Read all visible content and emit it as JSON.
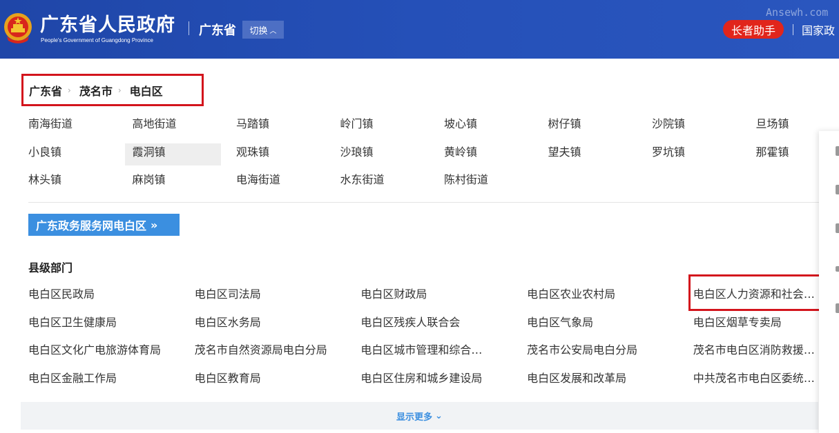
{
  "header": {
    "title": "广东省人民政府",
    "subtitle": "People's Government of Guangdong Province",
    "region": "广东省",
    "switch_label": "切换",
    "watermark": "Ansewh.com",
    "assistant_label": "长者助手",
    "national_link": "国家政"
  },
  "breadcrumb": {
    "items": [
      "广东省",
      "茂名市",
      "电白区"
    ]
  },
  "towns": [
    "南海街道",
    "高地街道",
    "马踏镇",
    "岭门镇",
    "坡心镇",
    "树仔镇",
    "沙院镇",
    "旦场镇",
    "小良镇",
    "霞洞镇",
    "观珠镇",
    "沙琅镇",
    "黄岭镇",
    "望夫镇",
    "罗坑镇",
    "那霍镇",
    "林头镇",
    "麻岗镇",
    "电海街道",
    "水东街道",
    "陈村街道"
  ],
  "highlighted_town": "霞洞镇",
  "service_button": "广东政务服务网电白区",
  "section_title": "县级部门",
  "departments": [
    "电白区民政局",
    "电白区司法局",
    "电白区财政局",
    "电白区农业农村局",
    "电白区人力资源和社会保障局",
    "电白区卫生健康局",
    "电白区水务局",
    "电白区残疾人联合会",
    "电白区气象局",
    "电白区烟草专卖局",
    "电白区文化广电旅游体育局",
    "茂名市自然资源局电白分局",
    "电白区城市管理和综合执法局",
    "茂名市公安局电白分局",
    "茂名市电白区消防救援大队",
    "电白区金融工作局",
    "电白区教育局",
    "电白区住房和城乡建设局",
    "电白区发展和改革局",
    "中共茂名市电白区委统战部"
  ],
  "show_more": "显示更多",
  "colors": {
    "header_bg": "#2550b8",
    "accent_red": "#d3141c",
    "link_blue": "#3b8fe0"
  }
}
